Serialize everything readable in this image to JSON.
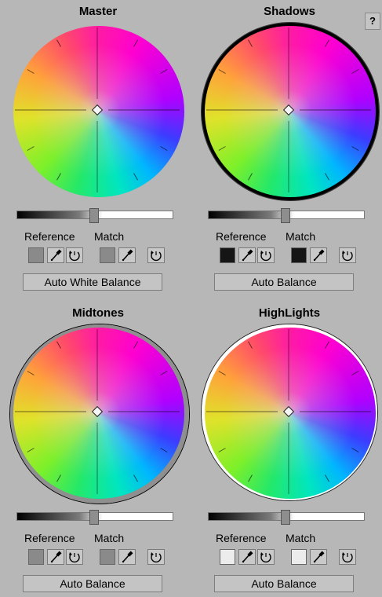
{
  "help_label": "?",
  "reference_label": "Reference",
  "match_label": "Match",
  "panels": [
    {
      "title": "Master",
      "button_label": "Auto White Balance",
      "swatch_color": "#8a8a8a",
      "ring": "none"
    },
    {
      "title": "Shadows",
      "button_label": "Auto Balance",
      "swatch_color": "#151515",
      "ring": "black"
    },
    {
      "title": "Midtones",
      "button_label": "Auto Balance",
      "swatch_color": "#8a8a8a",
      "ring": "gray"
    },
    {
      "title": "HighLights",
      "button_label": "Auto Balance",
      "swatch_color": "#ececec",
      "ring": "white"
    }
  ],
  "icons": {
    "eyedropper": "eyedropper-icon",
    "rotate": "rotate-icon"
  }
}
